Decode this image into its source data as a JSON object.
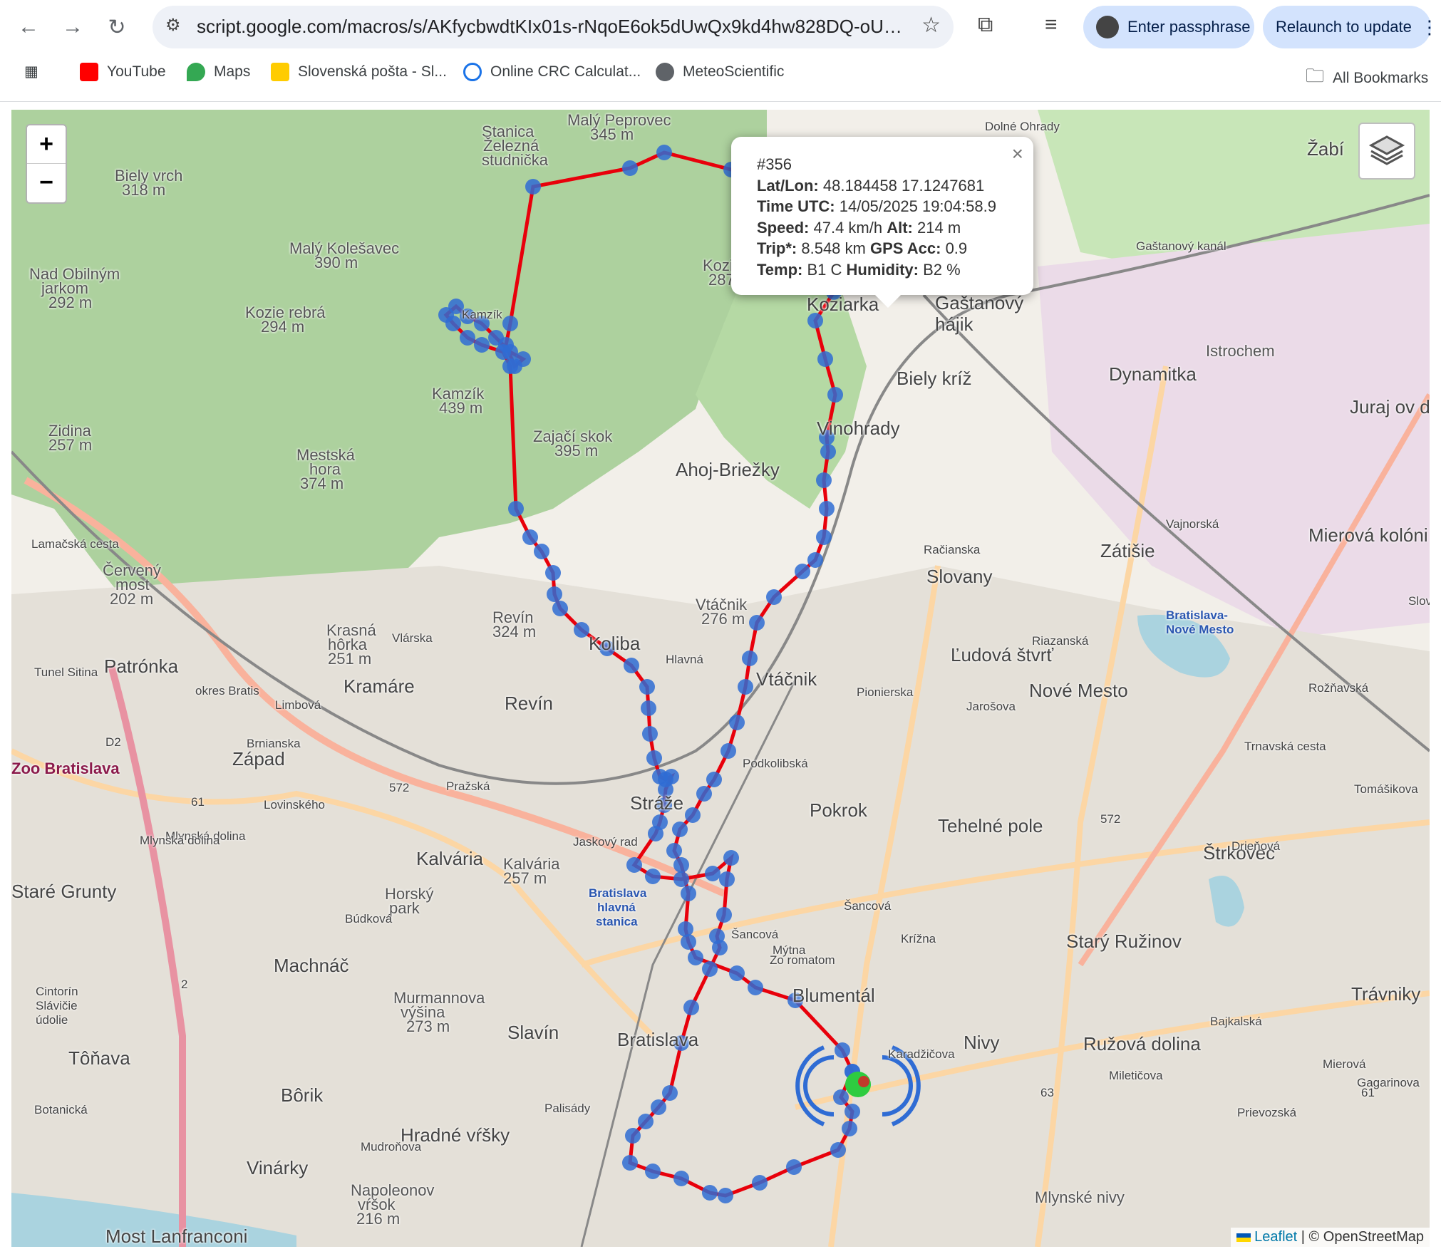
{
  "browser": {
    "url": "script.google.com/macros/s/AKfycbwdtKIx01s-rNqoE6ok5dUwQx9kd4hw828DQ-oUgG5...",
    "passphrase_button": "Enter passphrase",
    "relaunch_button": "Relaunch to update"
  },
  "bookmarks": {
    "items": [
      {
        "label": "YouTube",
        "color": "#ff0000"
      },
      {
        "label": "Maps",
        "color": "#34a853"
      },
      {
        "label": "Slovenská pošta - Sl...",
        "color": "#ffcc00"
      },
      {
        "label": "Online CRC Calculat...",
        "color": "#1a73e8"
      },
      {
        "label": "MeteoScientific",
        "color": "#5f6368"
      }
    ],
    "all_label": "All Bookmarks"
  },
  "map": {
    "zoom_in": "+",
    "zoom_out": "−",
    "track_color": "#e8000b",
    "point_color": "#2f6cd4",
    "labels": [
      "Malý Peprovec",
      "345 m",
      "Stanica",
      "Železná",
      "studnička",
      "Biely vrch",
      "318 m",
      "Malý Kolešavec",
      "390 m",
      "Nad Obilným",
      "jarkom",
      "292 m",
      "Kozie rebrá",
      "294 m",
      "Kamzík",
      "Kamzík",
      "439 m",
      "Zidina",
      "257 m",
      "Mestská",
      "hora",
      "374 m",
      "Zajačí skok",
      "395 m",
      "Koziarka",
      "287 m",
      "Koziarka",
      "Gaštanový",
      "hájik",
      "Biely kríž",
      "Vinohrady",
      "Ahoj-Briežky",
      "Dynamitka",
      "Istrochem",
      "Dolné Ohrady",
      "Žabí",
      "Juraj ov dv",
      "Mierová kolóni",
      "Zátišie",
      "Slovany",
      "Ľudová štvrť",
      "Nové Mesto",
      "Bratislava-",
      "Nové Mesto",
      "Červený",
      "most",
      "202 m",
      "Krasná",
      "hôrka",
      "251 m",
      "Revín",
      "324 m",
      "Koliba",
      "Vtáčnik",
      "276 m",
      "Vtáčnik",
      "Patrónka",
      "Kramáre",
      "Revín",
      "Západ",
      "Zoo Bratislava",
      "Pražská",
      "572",
      "Pokrok",
      "Tehelné pole",
      "Štrkovec",
      "Kalvária",
      "Kalvária",
      "257 m",
      "Horský",
      "park",
      "Mlynská dolina",
      "Staré Grunty",
      "Machnáč",
      "Bratislava",
      "hlavná",
      "stanica",
      "Šancová",
      "Šancová",
      "Starý Ružinov",
      "Trávniky",
      "Blumentál",
      "Murmannova",
      "výšina",
      "273 m",
      "Slavín",
      "Bratislava",
      "Nivy",
      "Ružová dolina",
      "Cintorín",
      "Slávičie",
      "údolie",
      "Tôňava",
      "Bôrik",
      "Hradné vŕšky",
      "Vinárky",
      "Napoleonov",
      "vŕšok",
      "216 m",
      "Mlynské nivy",
      "Most Lanfranconi",
      "Botanická",
      "Palisády",
      "Mudroňova",
      "D2",
      "2",
      "61",
      "572",
      "63",
      "61",
      "Stráže",
      "Račianska",
      "Trnavská cesta",
      "Gagarinova",
      "Mierová",
      "Prievozská",
      "Vajnorská",
      "Rožňavská",
      "Tomášikova",
      "Drieňová",
      "Bajkalská",
      "Miletičova",
      "Karadžičova",
      "Krížna",
      "Mýtna",
      "Pionierska",
      "Podkolibská",
      "Jaskový rad",
      "Hlavná",
      "Jarošova",
      "Riazanská",
      "Vlárska",
      "Limbová",
      "Brnianska",
      "Lovinského",
      "Búdková",
      "Lamačská cesta",
      "Tunel Sitina",
      "okres Bratis",
      "Mlynská dolina",
      "Gaštanový kanál",
      "Zo romatom",
      "Slovinská"
    ]
  },
  "popup": {
    "id": "#356",
    "latlon_label": "Lat/Lon:",
    "latlon_value": "48.184458 17.1247681",
    "time_label": "Time UTC:",
    "time_value": "14/05/2025 19:04:58.9",
    "speed_label": "Speed:",
    "speed_value": "47.4 km/h",
    "alt_label": "Alt:",
    "alt_value": "214 m",
    "trip_label": "Trip*:",
    "trip_value": "8.548 km",
    "gps_label": "GPS Acc:",
    "gps_value": "0.9",
    "temp_label": "Temp:",
    "temp_value": "B1 C",
    "hum_label": "Humidity:",
    "hum_value": "B2 %",
    "close": "×"
  },
  "attribution": {
    "leaflet": "Leaflet",
    "sep": " | © OpenStreetMap"
  }
}
